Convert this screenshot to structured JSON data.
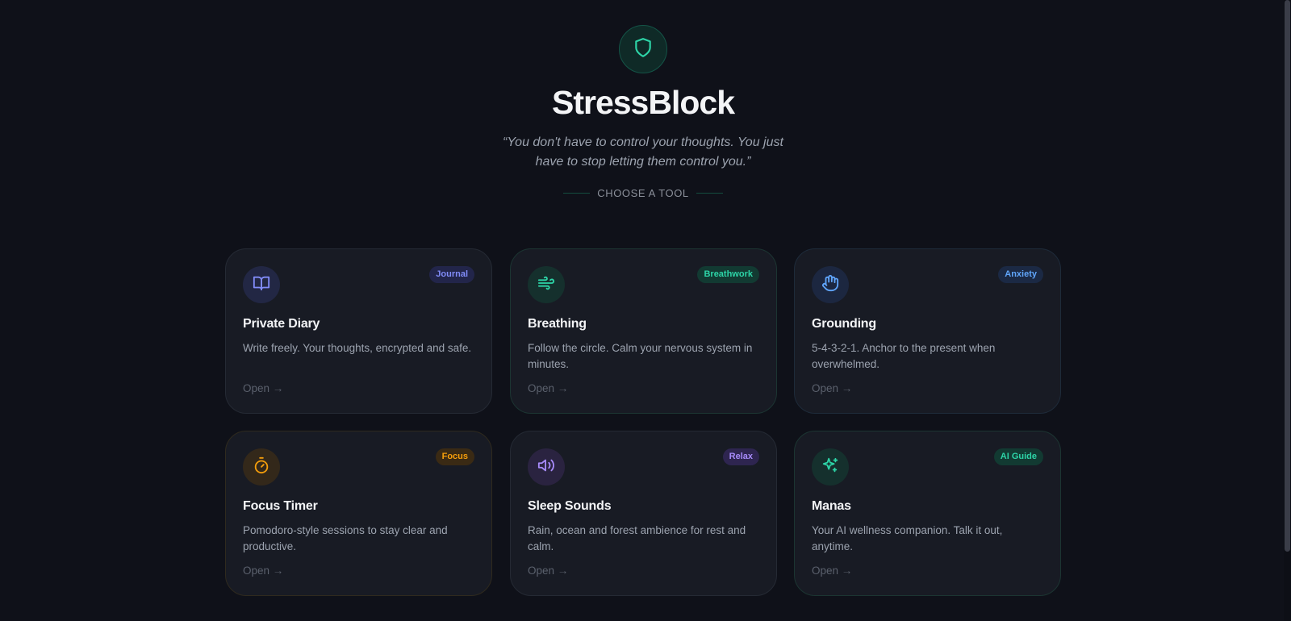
{
  "app": {
    "title": "StressBlock",
    "quote": "“You don't have to control your thoughts. You just have to stop letting them control you.”",
    "section_label": "CHOOSE A TOOL",
    "logo_icon": "shield-icon",
    "accent_color": "#2dd4a7"
  },
  "tools": [
    {
      "title": "Private Diary",
      "tag": "Journal",
      "description": "Write freely. Your thoughts, encrypted and safe.",
      "action": "Open →",
      "icon": "book-open-icon",
      "color": "#818cf8"
    },
    {
      "title": "Breathing",
      "tag": "Breathwork",
      "description": "Follow the circle. Calm your nervous system in minutes.",
      "action": "Open →",
      "icon": "wind-icon",
      "color": "#2dd4a7"
    },
    {
      "title": "Grounding",
      "tag": "Anxiety",
      "description": "5-4-3-2-1. Anchor to the present when overwhelmed.",
      "action": "Open →",
      "icon": "hand-icon",
      "color": "#60a5fa"
    },
    {
      "title": "Focus Timer",
      "tag": "Focus",
      "description": "Pomodoro-style sessions to stay clear and productive.",
      "action": "Open →",
      "icon": "timer-icon",
      "color": "#f59e0b"
    },
    {
      "title": "Sleep Sounds",
      "tag": "Relax",
      "description": "Rain, ocean and forest ambience for rest and calm.",
      "action": "Open →",
      "icon": "speaker-icon",
      "color": "#a78bfa"
    },
    {
      "title": "Manas",
      "tag": "AI Guide",
      "description": "Your AI wellness companion. Talk it out, anytime.",
      "action": "Open →",
      "icon": "sparkles-icon",
      "color": "#2dd4a7"
    }
  ]
}
